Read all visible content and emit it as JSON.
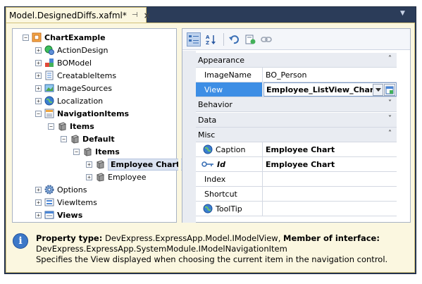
{
  "window": {
    "tab_title": "Model.DesignedDiffs.xafml*",
    "pin_glyph": "⊣",
    "close_glyph": "×",
    "menu_glyph": "▼"
  },
  "tree": {
    "nodes": [
      {
        "label": "ChartExample",
        "bold": true,
        "expander": "−",
        "icon": "app-icon"
      },
      {
        "label": "ActionDesign",
        "bold": false,
        "expander": "+",
        "icon": "action-design-icon"
      },
      {
        "label": "BOModel",
        "bold": false,
        "expander": "+",
        "icon": "bo-model-icon"
      },
      {
        "label": "CreatableItems",
        "bold": false,
        "expander": "+",
        "icon": "creatable-items-icon"
      },
      {
        "label": "ImageSources",
        "bold": false,
        "expander": "+",
        "icon": "image-sources-icon"
      },
      {
        "label": "Localization",
        "bold": false,
        "expander": "+",
        "icon": "globe-icon"
      },
      {
        "label": "NavigationItems",
        "bold": true,
        "expander": "−",
        "icon": "navigation-items-icon"
      },
      {
        "label": "Items",
        "bold": true,
        "expander": "−",
        "icon": "cube-icon"
      },
      {
        "label": "Default",
        "bold": true,
        "expander": "−",
        "icon": "cube-icon"
      },
      {
        "label": "Items",
        "bold": true,
        "expander": "−",
        "icon": "cube-icon"
      },
      {
        "label": "Employee Chart",
        "bold": true,
        "expander": "+",
        "icon": "cube-icon",
        "selected": true
      },
      {
        "label": "Employee",
        "bold": false,
        "expander": "+",
        "icon": "cube-icon"
      },
      {
        "label": "Options",
        "bold": false,
        "expander": "+",
        "icon": "gear-icon"
      },
      {
        "label": "ViewItems",
        "bold": false,
        "expander": "+",
        "icon": "view-items-icon"
      },
      {
        "label": "Views",
        "bold": true,
        "expander": "+",
        "icon": "views-icon"
      }
    ]
  },
  "toolbar": {
    "buttons": [
      "categorized-sort-icon",
      "alphabetical-sort-icon",
      "undo-icon",
      "reset-icon",
      "link-icon"
    ]
  },
  "property_grid": {
    "categories": {
      "appearance": "Appearance",
      "behavior": "Behavior",
      "data": "Data",
      "misc": "Misc"
    },
    "chevron_expanded": "˄",
    "chevron_collapsed": "˅",
    "rows": {
      "imagename": {
        "name": "ImageName",
        "value": "BO_Person"
      },
      "view": {
        "name": "View",
        "value": "Employee_ListView_Chart"
      },
      "caption": {
        "name": "Caption",
        "value": "Employee Chart"
      },
      "id": {
        "name": "Id",
        "value": "Employee Chart"
      },
      "index": {
        "name": "Index",
        "value": ""
      },
      "shortcut": {
        "name": "Shortcut",
        "value": ""
      },
      "tooltip": {
        "name": "ToolTip",
        "value": ""
      }
    }
  },
  "description": {
    "label_type": "Property type:",
    "type_value": "DevExpress.ExpressApp.Model.IModelView,",
    "label_member": "Member of interface:",
    "member_value": "DevExpress.ExpressApp.SystemModule.IModelNavigationItem",
    "text": "Specifies the View displayed when choosing the current item in the navigation control."
  },
  "colors": {
    "frame": "#2b3c59",
    "tab": "#fbf7e0",
    "selected_row": "#3d8ee5"
  }
}
